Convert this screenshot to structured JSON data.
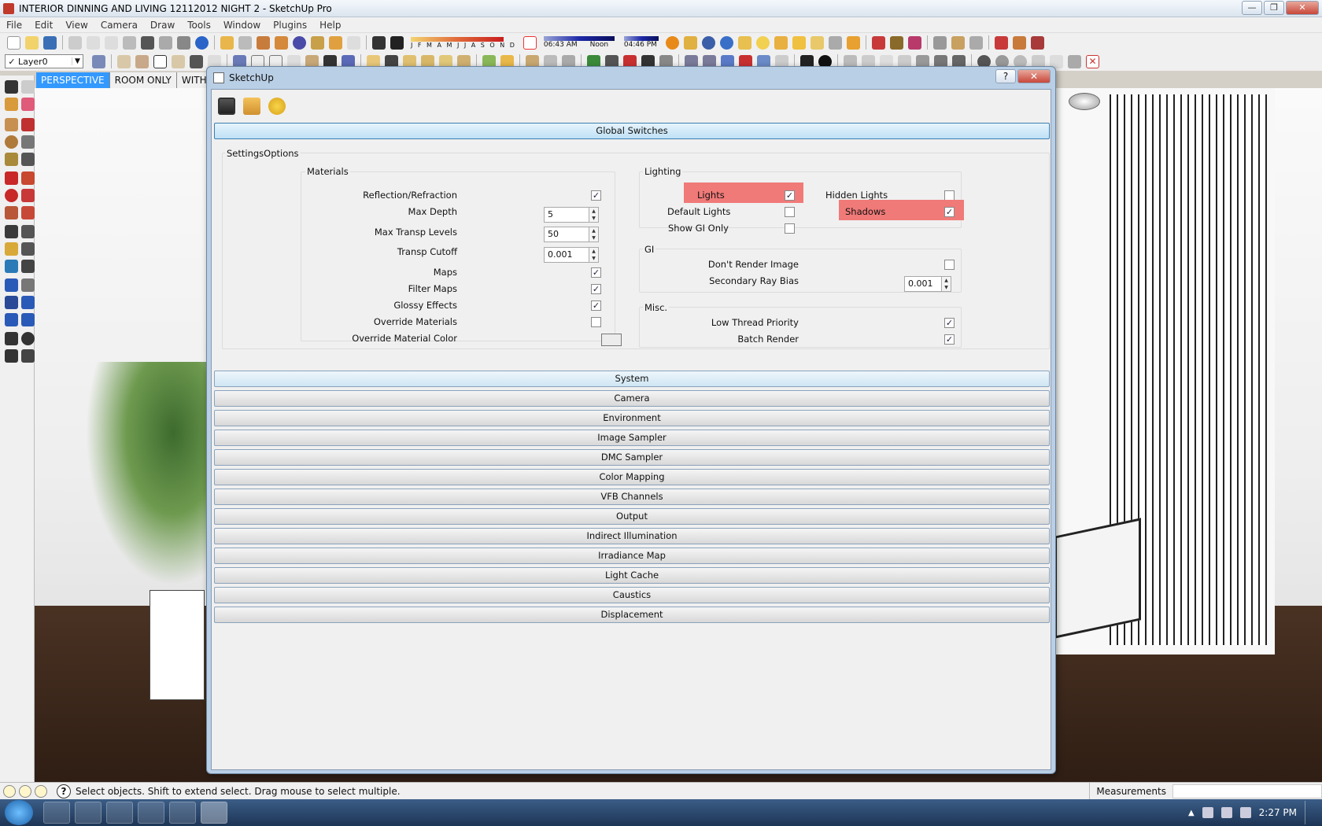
{
  "window": {
    "title": "INTERIOR DINNING AND LIVING 12112012 NIGHT 2 - SketchUp Pro",
    "min": "—",
    "max": "❐",
    "close": "✕"
  },
  "menu": [
    "File",
    "Edit",
    "View",
    "Camera",
    "Draw",
    "Tools",
    "Window",
    "Plugins",
    "Help"
  ],
  "toolbar": {
    "layer": "Layer0",
    "months": "J F M A M J J A S O N D",
    "time_start": "06:43 AM",
    "time_noon": "Noon",
    "time_end": "04:46 PM"
  },
  "scene_tabs": [
    "PERSPECTIVE",
    "ROOM ONLY",
    "WITHOU"
  ],
  "dialog": {
    "title": "SketchUp",
    "help": "?",
    "close": "✕",
    "sections": {
      "global": "Global Switches",
      "settings_options": "SettingsOptions",
      "materials": {
        "title": "Materials",
        "reflection": "Reflection/Refraction",
        "max_depth": "Max Depth",
        "max_depth_val": "5",
        "max_transp": "Max Transp Levels",
        "max_transp_val": "50",
        "transp_cutoff": "Transp Cutoff",
        "transp_cutoff_val": "0.001",
        "maps": "Maps",
        "filter_maps": "Filter Maps",
        "glossy": "Glossy Effects",
        "override_materials": "Override Materials",
        "override_color": "Override Material Color"
      },
      "lighting": {
        "title": "Lighting",
        "lights": "Lights",
        "hidden_lights": "Hidden Lights",
        "default_lights": "Default Lights",
        "shadows": "Shadows",
        "show_gi_only": "Show GI Only"
      },
      "gi": {
        "title": "GI",
        "dont_render": "Don't Render Image",
        "secondary_bias": "Secondary Ray Bias",
        "secondary_bias_val": "0.001"
      },
      "misc": {
        "title": "Misc.",
        "low_thread": "Low Thread Priority",
        "batch_render": "Batch Render"
      },
      "collapsed": [
        "System",
        "Camera",
        "Environment",
        "Image Sampler",
        "DMC Sampler",
        "Color Mapping",
        "VFB Channels",
        "Output",
        "Indirect Illumination",
        "Irradiance Map",
        "Light Cache",
        "Caustics",
        "Displacement"
      ]
    }
  },
  "status": {
    "message": "Select objects. Shift to extend select. Drag mouse to select multiple.",
    "measurements": "Measurements"
  },
  "taskbar": {
    "clock": "2:27 PM"
  },
  "colors": {
    "highlight": "#f07a78",
    "active_tab": "#3399ff"
  }
}
